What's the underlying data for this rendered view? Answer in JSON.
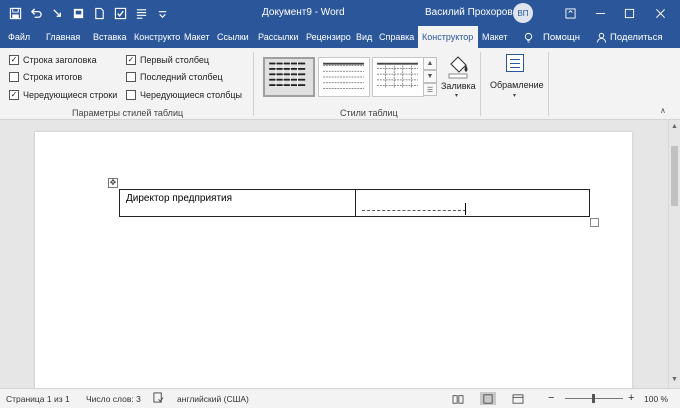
{
  "title_bar": {
    "document_title": "Документ9 - Word",
    "user_name": "Василий Прохоров",
    "user_initials": "ВП",
    "bg_color": "#2b579a"
  },
  "quick_access": [
    {
      "name": "save-icon"
    },
    {
      "name": "undo-icon"
    },
    {
      "name": "redo-icon"
    },
    {
      "name": "autosave-icon"
    },
    {
      "name": "new-doc-icon"
    },
    {
      "name": "spelling-icon"
    },
    {
      "name": "paragraph-icon"
    },
    {
      "name": "customize-qat-icon"
    }
  ],
  "tabs": [
    {
      "label": "Файл",
      "name": "tab-file"
    },
    {
      "label": "Главная",
      "name": "tab-home"
    },
    {
      "label": "Вставка",
      "name": "tab-insert"
    },
    {
      "label": "Конструкто",
      "name": "tab-design"
    },
    {
      "label": "Макет",
      "name": "tab-layout"
    },
    {
      "label": "Ссылки",
      "name": "tab-references"
    },
    {
      "label": "Рассылки",
      "name": "tab-mailings"
    },
    {
      "label": "Рецензиро",
      "name": "tab-review"
    },
    {
      "label": "Вид",
      "name": "tab-view"
    },
    {
      "label": "Справка",
      "name": "tab-help"
    },
    {
      "label": "Конструктор",
      "name": "tab-table-design",
      "active": true
    },
    {
      "label": "Макет",
      "name": "tab-table-layout"
    }
  ],
  "tell_me": "Помощн",
  "share": "Поделиться",
  "ribbon": {
    "table_style_options": {
      "col1": [
        {
          "label": "Строка заголовка",
          "checked": true
        },
        {
          "label": "Строка итогов",
          "checked": false
        },
        {
          "label": "Чередующиеся строки",
          "checked": true
        }
      ],
      "col2": [
        {
          "label": "Первый столбец",
          "checked": true
        },
        {
          "label": "Последний столбец",
          "checked": false
        },
        {
          "label": "Чередующиеся столбцы",
          "checked": false
        }
      ],
      "group_label": "Параметры стилей таблиц"
    },
    "table_styles_label": "Стили таблиц",
    "shading_label": "Заливка",
    "borders_label": "Обрамление",
    "check_mark": "✓"
  },
  "document": {
    "cell1_text": "Директор предприятия"
  },
  "status_bar": {
    "page": "Страница 1 из 1",
    "words": "Число слов: 3",
    "language": "английский (США)",
    "zoom": "100 %"
  }
}
